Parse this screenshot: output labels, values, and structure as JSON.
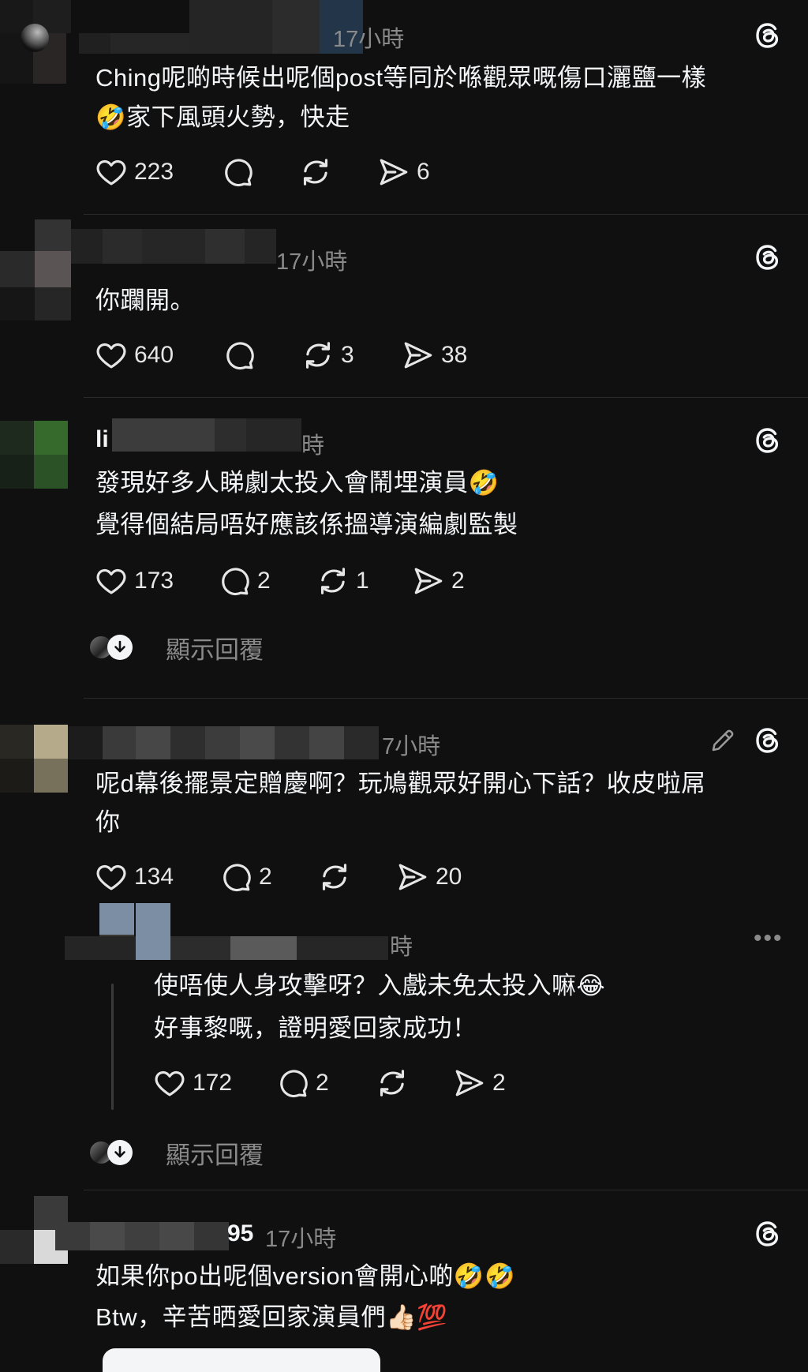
{
  "posts": [
    {
      "time": "17小時",
      "lines": [
        "Ching呢啲時候出呢個post等同於喺觀眾嘅傷口灑鹽一樣",
        "🤣家下風頭火勢，快走"
      ],
      "likes": "223",
      "replies": "",
      "reposts": "",
      "shares": "6"
    },
    {
      "time": "17小時",
      "lines": [
        "你躝開。"
      ],
      "likes": "640",
      "replies": "",
      "reposts": "3",
      "shares": "38"
    },
    {
      "username_fragment": "li",
      "time": "時",
      "lines": [
        "發現好多人睇劇太投入會鬧埋演員🤣",
        "覺得個結局唔好應該係搵導演編劇監製"
      ],
      "likes": "173",
      "replies": "2",
      "reposts": "1",
      "shares": "2",
      "show_replies": "顯示回覆"
    },
    {
      "time": "7小時",
      "lines": [
        "呢d幕後擺景定贈慶啊？玩鳩觀眾好開心下話？收皮啦屌",
        "你"
      ],
      "likes": "134",
      "replies": "2",
      "reposts": "",
      "shares": "20"
    },
    {
      "time": "時",
      "lines": [
        "使唔使人身攻擊呀？入戲未免太投入嘛😂",
        "好事黎嘅，證明愛回家成功！"
      ],
      "likes": "172",
      "replies": "2",
      "reposts": "",
      "shares": "2",
      "show_replies": "顯示回覆"
    },
    {
      "username_fragment": "95",
      "time": "17小時",
      "lines": [
        "如果你po出呢個version會開心啲🤣🤣",
        "Btw，辛苦晒愛回家演員們👍🏻💯"
      ]
    }
  ],
  "icons": {
    "like": "heart-icon",
    "reply": "comment-icon",
    "repost": "repost-icon",
    "share": "send-icon",
    "threads": "threads-logo-icon",
    "edit": "pencil-icon",
    "more": "more-icon",
    "expand": "arrow-down-icon"
  },
  "colors": {
    "background": "#101010",
    "text": "#f3f5f7",
    "secondary": "#8a8a8a"
  }
}
